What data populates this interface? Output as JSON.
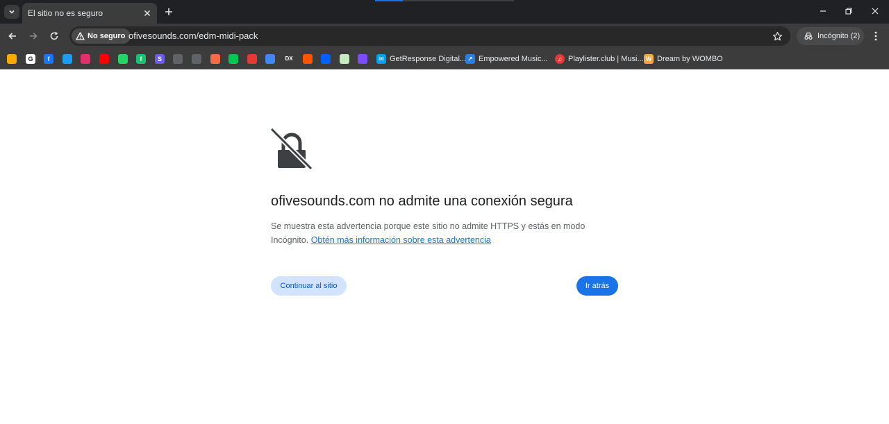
{
  "tab": {
    "title": "El sitio no es seguro"
  },
  "omnibox": {
    "security_label": "No seguro",
    "url": "ofivesounds.com/edm-midi-pack"
  },
  "profile": {
    "label": "Incógnito (2)"
  },
  "bookmarks": [
    {
      "label": "GetResponse Digital...",
      "icon": "getresponse-icon"
    },
    {
      "label": "Empowered Music...",
      "icon": "empowered-music-icon"
    },
    {
      "label": "Playlister.club | Musi...",
      "icon": "playlister-icon"
    },
    {
      "label": "Dream by WOMBO",
      "icon": "wombo-icon"
    }
  ],
  "bookmark_icons": [
    {
      "name": "analytics-icon",
      "color": "#f9ab00",
      "glyph": ""
    },
    {
      "name": "google-icon",
      "color": "#ffffff",
      "glyph": "G"
    },
    {
      "name": "facebook-icon",
      "color": "#1877f2",
      "glyph": "f"
    },
    {
      "name": "twitter-icon",
      "color": "#1d9bf0",
      "glyph": ""
    },
    {
      "name": "instagram-icon",
      "color": "#e1306c",
      "glyph": ""
    },
    {
      "name": "youtube-icon",
      "color": "#ff0000",
      "glyph": ""
    },
    {
      "name": "whatsapp-icon",
      "color": "#25d366",
      "glyph": ""
    },
    {
      "name": "fiverr-icon",
      "color": "#1dbf73",
      "glyph": "f"
    },
    {
      "name": "s-app-icon",
      "color": "#6c5ce7",
      "glyph": "S"
    },
    {
      "name": "dark-circle-icon",
      "color": "#5f6368",
      "glyph": ""
    },
    {
      "name": "dark-circle-icon-2",
      "color": "#5f6368",
      "glyph": ""
    },
    {
      "name": "heart-app-icon",
      "color": "#f46b45",
      "glyph": ""
    },
    {
      "name": "chat-icon",
      "color": "#00c853",
      "glyph": ""
    },
    {
      "name": "flash-icon",
      "color": "#e53935",
      "glyph": ""
    },
    {
      "name": "translate-icon",
      "color": "#4285f4",
      "glyph": ""
    },
    {
      "name": "dx-icon",
      "color": "#3c3c3c",
      "glyph": "DX"
    },
    {
      "name": "soundcloud-icon",
      "color": "#ff5500",
      "glyph": ""
    },
    {
      "name": "dropbox-icon",
      "color": "#0061ff",
      "glyph": ""
    },
    {
      "name": "record-icon",
      "color": "#c6e8c0",
      "glyph": ""
    },
    {
      "name": "music-app-icon",
      "color": "#7c4dff",
      "glyph": ""
    }
  ],
  "page": {
    "heading": "ofivesounds.com no admite una conexión segura",
    "description": "Se muestra esta advertencia porque este sitio no admite HTTPS y estás en modo Incógnito. ",
    "learn_more_link": "Obtén más información sobre esta advertencia",
    "continue_button": "Continuar al sitio",
    "back_button": "Ir atrás"
  },
  "colors": {
    "accent": "#1a73e8",
    "secondary_button_bg": "#d3e3fd",
    "chrome_dark": "#3c3c3c"
  }
}
